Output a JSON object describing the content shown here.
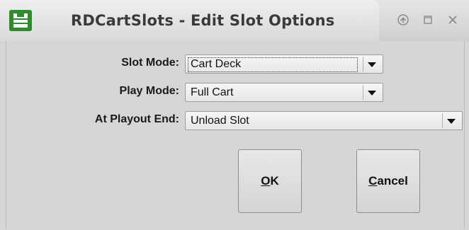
{
  "window": {
    "title": "RDCartSlots - Edit Slot Options",
    "icon": "rivendell-app-icon",
    "controls": [
      "restore-icon",
      "maximize-icon",
      "close-icon"
    ]
  },
  "form": {
    "slot_mode": {
      "label": "Slot Mode:",
      "value": "Cart Deck"
    },
    "play_mode": {
      "label": "Play Mode:",
      "value": "Full Cart"
    },
    "playout_end": {
      "label": "At Playout End:",
      "value": "Unload Slot"
    }
  },
  "buttons": {
    "ok": {
      "label_underlined": "O",
      "label_rest": "K"
    },
    "cancel": {
      "label_underlined": "C",
      "label_rest": "ancel"
    }
  }
}
